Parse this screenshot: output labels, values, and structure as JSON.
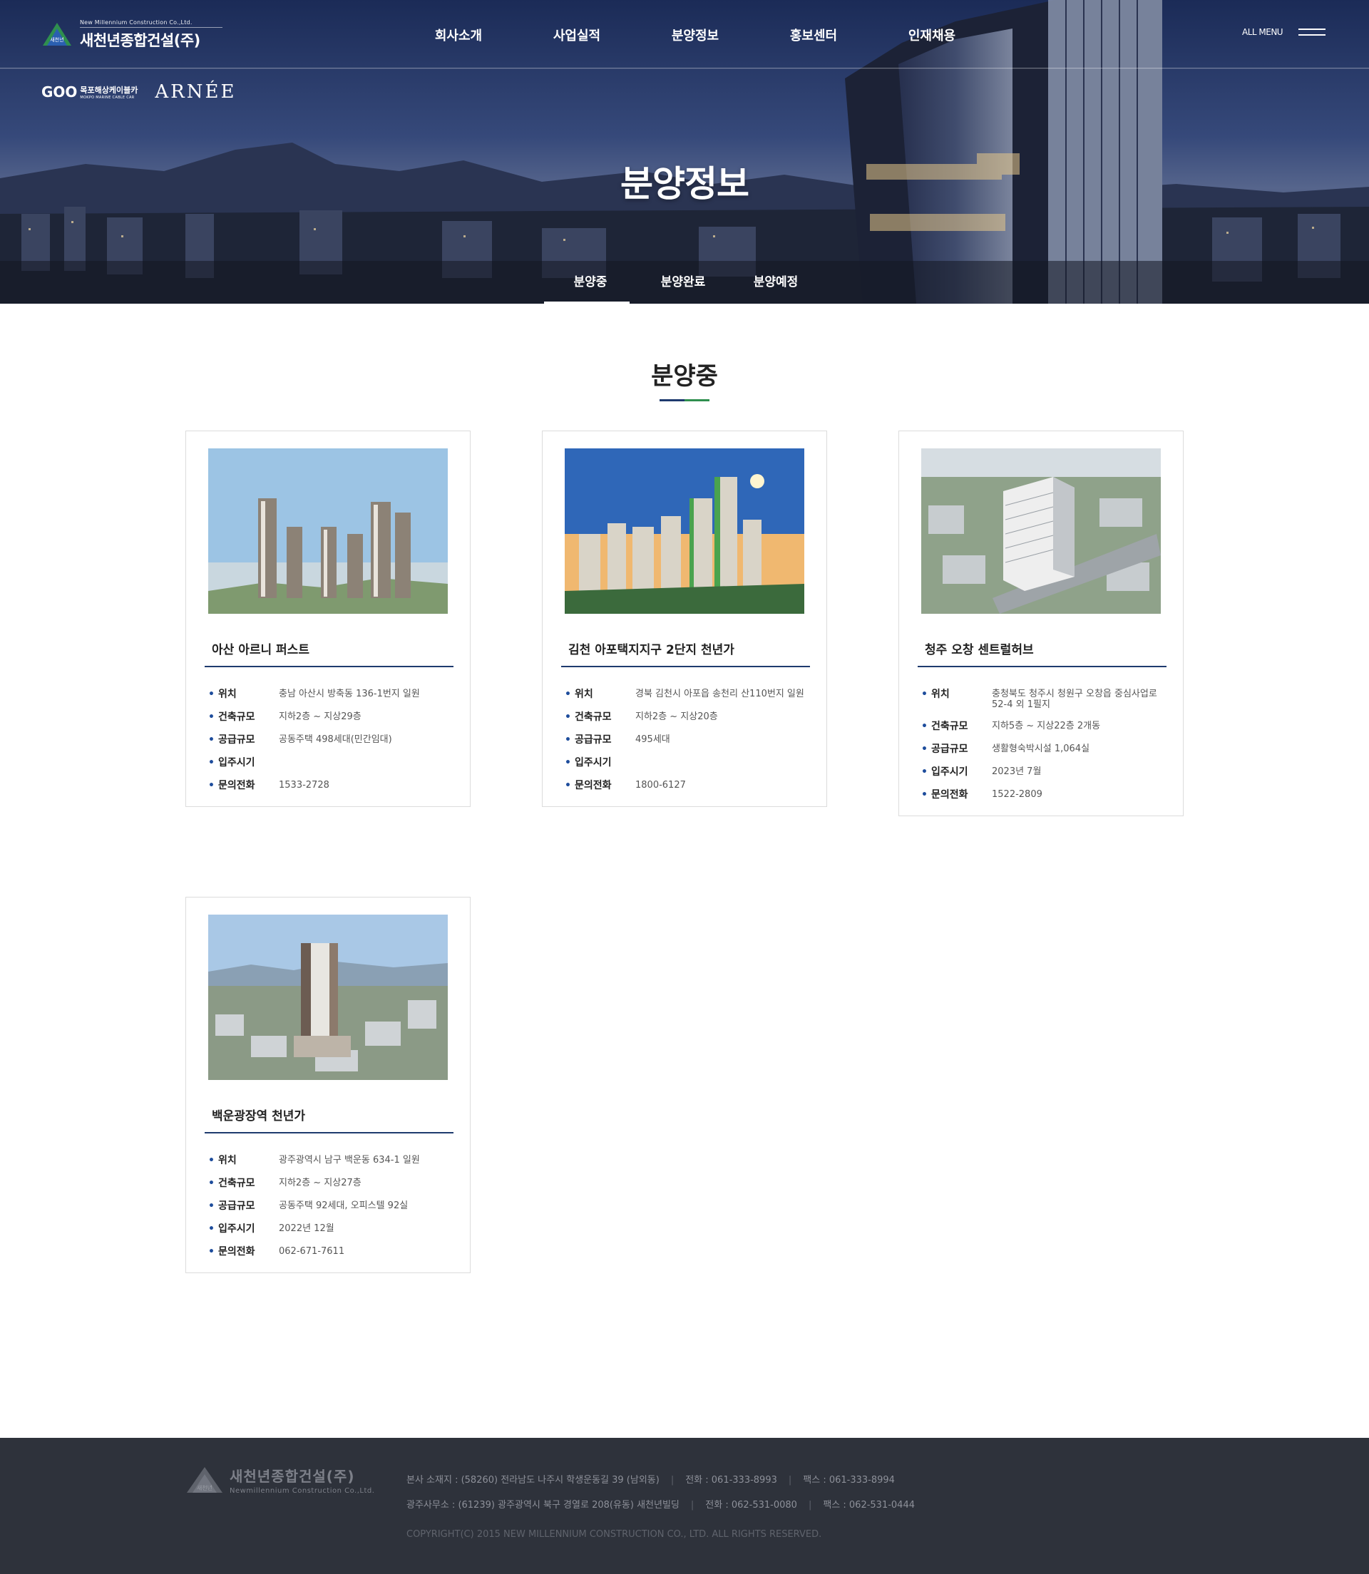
{
  "header": {
    "logo_en": "New Millennium Construction Co.,Ltd.",
    "logo_kr": "새천년종합건설(주)",
    "logo_mark_text": "새천년",
    "nav": [
      "회사소개",
      "사업실적",
      "분양정보",
      "홍보센터",
      "인재채용"
    ],
    "allmenu_label": "ALL MENU"
  },
  "partner_logos": {
    "cable_mark": "GOO",
    "cable_kr": "목포해상케이블카",
    "cable_en": "MOKPO MARINE CABLE CAR",
    "arnee": "ARNÉE"
  },
  "hero": {
    "title": "분양정보"
  },
  "subnav": {
    "items": [
      "분양중",
      "분양완료",
      "분양예정"
    ],
    "active": "분양중"
  },
  "section": {
    "title": "분양중"
  },
  "labels": {
    "location": "위치",
    "scale": "건축규모",
    "supply": "공급규모",
    "move_in": "입주시기",
    "phone": "문의전화"
  },
  "projects": [
    {
      "name": "아산 아르니 퍼스트",
      "location": "충남 아산시 방축동 136-1번지 일원",
      "scale": "지하2층 ~ 지상29층",
      "supply": "공동주택 498세대(민간임대)",
      "move_in": "",
      "phone": "1533-2728"
    },
    {
      "name": "김천 아포택지지구 2단지 천년가",
      "location": "경북 김천시 아포읍 송천리 산110번지 일원",
      "scale": "지하2층 ~ 지상20층",
      "supply": "495세대",
      "move_in": "",
      "phone": "1800-6127"
    },
    {
      "name": "청주 오창 센트럴허브",
      "location": "충청북도 청주시 청원구 오창읍 중심사업로 52-4 외 1필지",
      "scale": "지하5층 ~ 지상22층 2개동",
      "supply": "생활형숙박시설 1,064실",
      "move_in": "2023년 7월",
      "phone": "1522-2809"
    },
    {
      "name": "백운광장역 천년가",
      "location": "광주광역시 남구 백운동 634-1 일원",
      "scale": "지하2층 ~ 지상27층",
      "supply": "공동주택 92세대, 오피스텔 92실",
      "move_in": "2022년 12월",
      "phone": "062-671-7611"
    }
  ],
  "footer": {
    "logo_kr": "새천년종합건설(주)",
    "logo_en": "Newmillennium Construction Co.,Ltd.",
    "logo_mark_text": "새천년",
    "line1": [
      "본사 소재지 : (58260) 전라남도 나주시 학생운동길 39 (남외동)",
      "전화 : 061-333-8993",
      "팩스 : 061-333-8994"
    ],
    "line2": [
      "광주사무소 : (61239) 광주광역시 북구 경열로 208(유동) 새천년빌딩",
      "전화 : 062-531-0080",
      "팩스 : 062-531-0444"
    ],
    "copyright": "COPYRIGHT(C) 2015 NEW MILLENNIUM CONSTRUCTION CO., LTD. ALL RIGHTS RESERVED."
  },
  "colors": {
    "navy": "#1e3a6e",
    "accent_green": "#2f8f4e",
    "accent_blue": "#1e4d9c",
    "footer_bg": "#2e323b"
  }
}
